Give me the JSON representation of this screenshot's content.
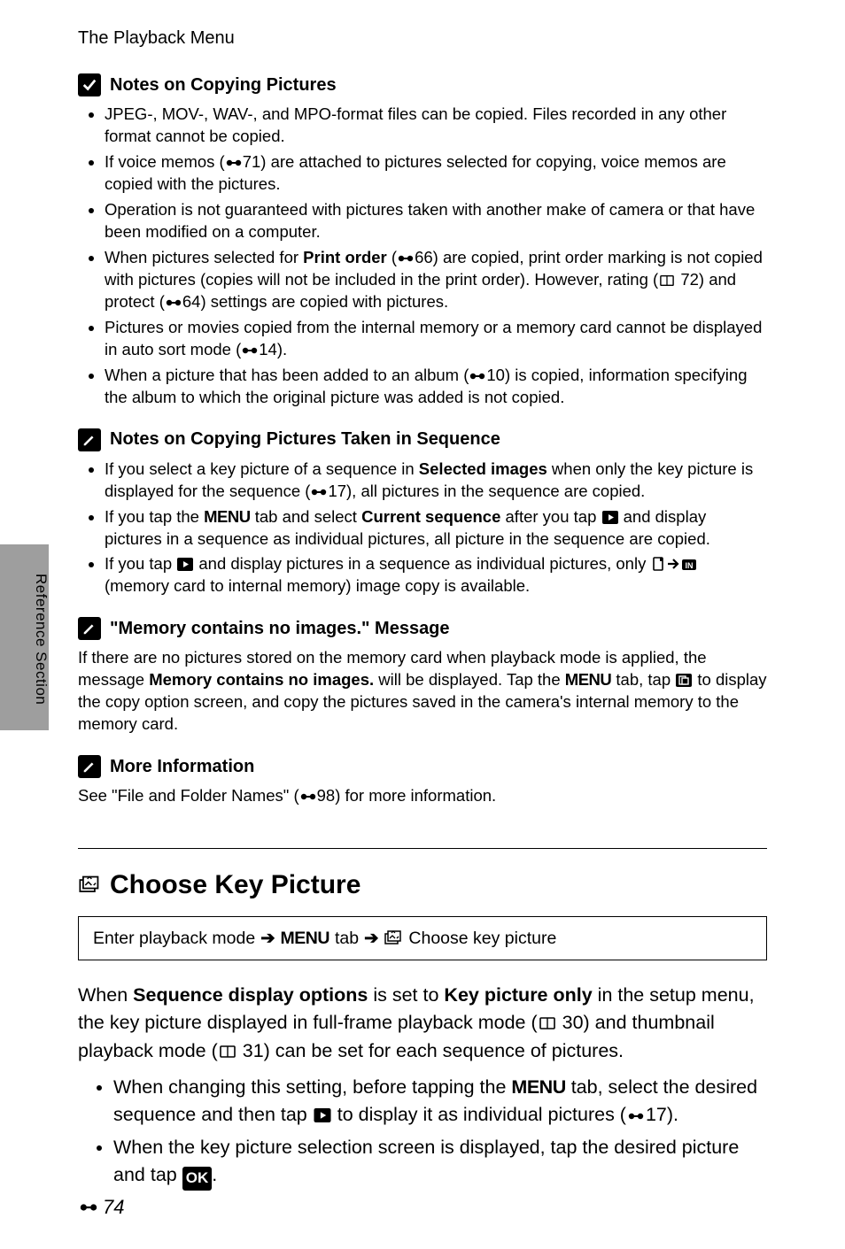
{
  "breadcrumb": "The Playback Menu",
  "side_label": "Reference Section",
  "page_number": "74",
  "s1": {
    "title": "Notes on Copying Pictures",
    "b1": "JPEG-, MOV-, WAV-, and MPO-format files can be copied. Files recorded in any other format cannot be copied.",
    "b2a": "If voice memos (",
    "b2_ref": "71",
    "b2b": ") are attached to pictures selected for copying, voice memos are copied with the pictures.",
    "b3": "Operation is not guaranteed with pictures taken with another make of camera or that have been modified on a computer.",
    "b4a": "When pictures selected for ",
    "b4_bold": "Print order",
    "b4b": " (",
    "b4_ref1": "66",
    "b4c": ") are copied, print order marking is not copied with pictures (copies will not be included in the print order). However, rating (",
    "b4_ref2": "72",
    "b4d": ") and protect (",
    "b4_ref3": "64",
    "b4e": ") settings are copied with pictures.",
    "b5a": "Pictures or movies copied from the internal memory or a memory card cannot be displayed in auto sort mode (",
    "b5_ref": "14",
    "b5b": ").",
    "b6a": "When a picture that has been added to an album (",
    "b6_ref": "10",
    "b6b": ") is copied, information specifying the album to which the original picture was added is not copied."
  },
  "s2": {
    "title": "Notes on Copying Pictures Taken in Sequence",
    "b1a": "If you select a key picture of a sequence in ",
    "b1_bold": "Selected images",
    "b1b": " when only the key picture is displayed for the sequence (",
    "b1_ref": "17",
    "b1c": "), all pictures in the sequence are copied.",
    "b2a": "If you tap the ",
    "b2_menu": "MENU",
    "b2b": " tab and select ",
    "b2_bold": "Current sequence",
    "b2c": " after you tap ",
    "b2d": " and display pictures in a sequence as individual pictures, all picture in the sequence are copied.",
    "b3a": "If you tap ",
    "b3b": " and display pictures in a sequence as individual pictures, only ",
    "b3c": " (memory card to internal memory) image copy is available."
  },
  "s3": {
    "title": "\"Memory contains no images.\" Message",
    "p_a": "If there are no pictures stored on the memory card when playback mode is applied, the message ",
    "p_bold": "Memory contains no images.",
    "p_b": " will be displayed. Tap the ",
    "p_menu": "MENU",
    "p_c": " tab, tap ",
    "p_d": " to display the copy option screen, and copy the pictures saved in the camera's internal memory to the memory card."
  },
  "s4": {
    "title": "More Information",
    "p_a": "See \"File and Folder Names\" (",
    "p_ref": "98",
    "p_b": ") for more information."
  },
  "main": {
    "heading": "Choose Key Picture",
    "nav_a": "Enter playback mode",
    "nav_menu": "MENU",
    "nav_b": "tab",
    "nav_c": "Choose key picture",
    "p_a": "When ",
    "p_bold1": "Sequence display options",
    "p_b": " is set to ",
    "p_bold2": "Key picture only",
    "p_c": " in the setup menu, the key picture displayed in full-frame playback mode (",
    "p_ref1": "30",
    "p_d": ") and thumbnail playback mode (",
    "p_ref2": "31",
    "p_e": ") can be set for each sequence of pictures.",
    "b1a": "When changing this setting, before tapping the ",
    "b1_menu": "MENU",
    "b1b": " tab, select the desired sequence and then tap ",
    "b1c": " to display it as individual pictures (",
    "b1_ref": "17",
    "b1d": ").",
    "b2a": "When the key picture selection screen is displayed, tap the desired picture and tap ",
    "b2_ok": "OK",
    "b2b": "."
  }
}
